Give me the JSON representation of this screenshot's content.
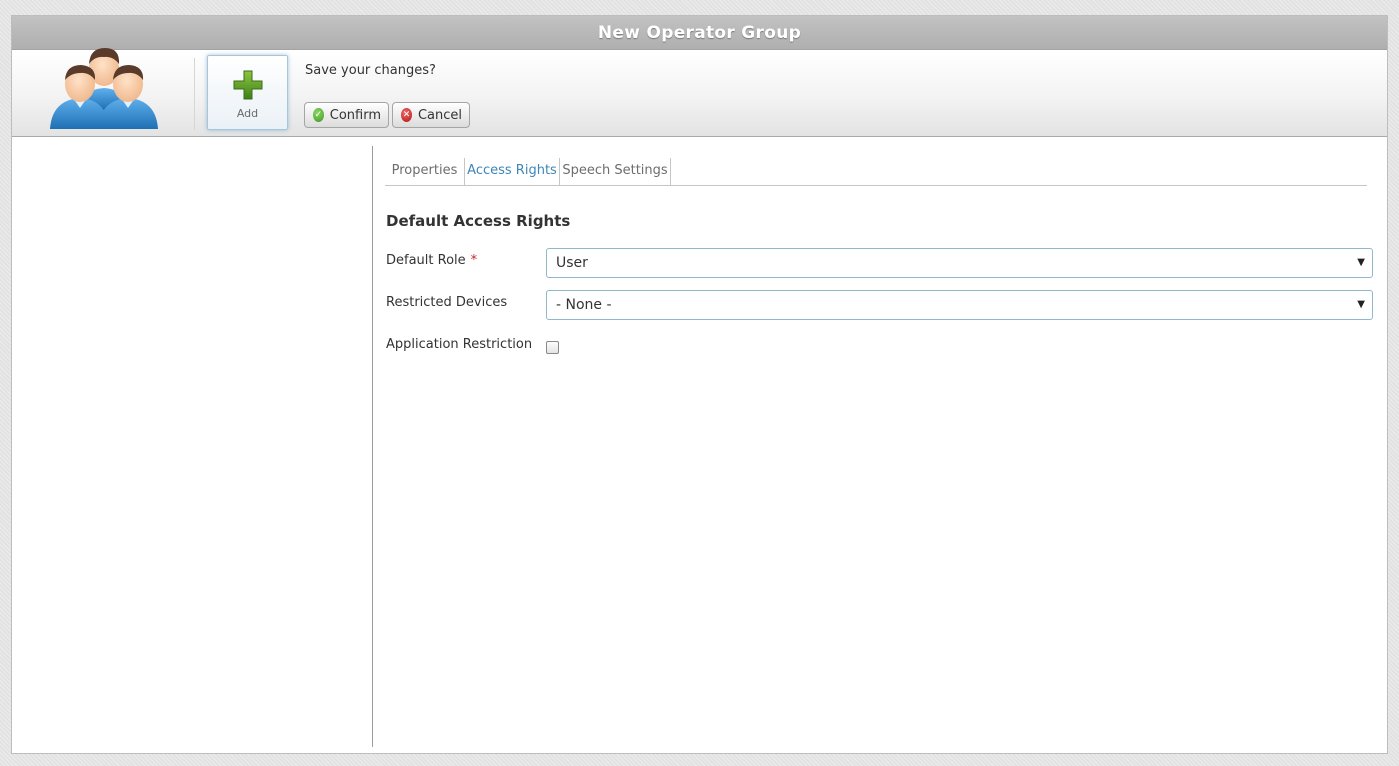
{
  "window": {
    "title": "New Operator Group"
  },
  "toolbar": {
    "group_icon": "operator-group-icon",
    "add": {
      "icon": "plus-icon",
      "label": "Add"
    },
    "save_prompt": "Save your changes?",
    "confirm_label": "Confirm",
    "cancel_label": "Cancel"
  },
  "tabs": [
    {
      "label": "Properties",
      "active": false
    },
    {
      "label": "Access Rights",
      "active": true
    },
    {
      "label": "Speech Settings",
      "active": false
    }
  ],
  "form": {
    "section_title": "Default Access Rights",
    "default_role": {
      "label": "Default Role",
      "required_marker": "*",
      "value": "User"
    },
    "restricted_devices": {
      "label": "Restricted Devices",
      "value": "- None -"
    },
    "application_restriction": {
      "label": "Application Restriction",
      "checked": false
    }
  },
  "colors": {
    "active_tab": "#3c86b8",
    "required": "#cc2222",
    "titlebar": "#b8b8b8",
    "confirm_icon": "#3a9a1f",
    "cancel_icon": "#b21414",
    "add_icon": "#5a9a2a"
  }
}
